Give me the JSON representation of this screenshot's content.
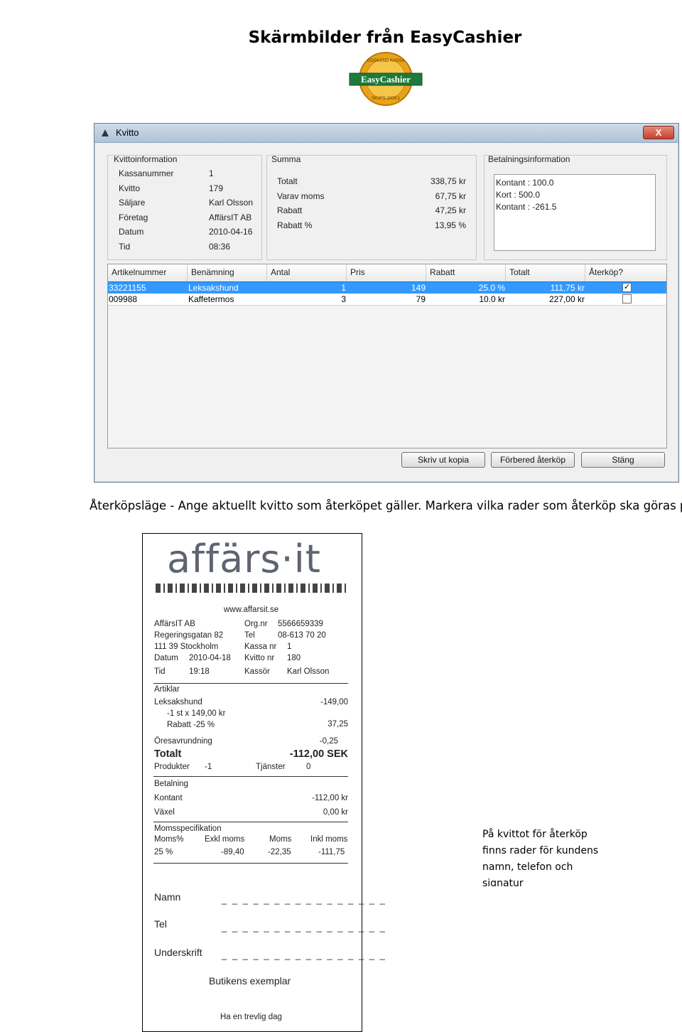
{
  "document_title": "Skärmbilder från EasyCashier",
  "logo": {
    "top_text": "GODKÄND KASSA",
    "name": "EasyCashier",
    "bottom_text": "SKVFS 2009:1"
  },
  "window": {
    "title": "Kvitto",
    "close_label": "X",
    "receipt_info": {
      "title": "Kvittoinformation",
      "rows": [
        {
          "label": "Kassanummer",
          "value": "1"
        },
        {
          "label": "Kvitto",
          "value": "179"
        },
        {
          "label": "Säljare",
          "value": "Karl Olsson"
        },
        {
          "label": "Företag",
          "value": "AffärsIT AB"
        },
        {
          "label": "Datum",
          "value": "2010-04-16"
        },
        {
          "label": "Tid",
          "value": "08:36"
        }
      ]
    },
    "summary": {
      "title": "Summa",
      "rows": [
        {
          "label": "Totalt",
          "value": "338,75 kr"
        },
        {
          "label": "Varav moms",
          "value": "67,75 kr"
        },
        {
          "label": "Rabatt",
          "value": "47,25 kr"
        },
        {
          "label": "Rabatt %",
          "value": "13,95 %"
        }
      ]
    },
    "payment": {
      "title": "Betalningsinformation",
      "lines": [
        "Kontant : 100.0",
        "Kort : 500.0",
        "Kontant : -261.5"
      ]
    },
    "grid": {
      "columns": [
        "Artikelnummer",
        "Benämning",
        "Antal",
        "Pris",
        "Rabatt",
        "Totalt",
        "Återköp?"
      ],
      "rows": [
        {
          "artnr": "33221155",
          "name": "Leksakshund",
          "qty": "1",
          "price": "149",
          "discount": "25.0 %",
          "total": "111,75 kr",
          "checked": true,
          "selected": true,
          "check_mark": "✓"
        },
        {
          "artnr": "009988",
          "name": "Kaffetermos",
          "qty": "3",
          "price": "79",
          "discount": "10.0 kr",
          "total": "227,00 kr",
          "checked": false,
          "selected": false,
          "check_mark": ""
        }
      ]
    },
    "buttons": {
      "print": "Skriv ut kopia",
      "prepare": "Förbered återköp",
      "close": "Stäng"
    }
  },
  "caption": "Återköpsläge - Ange aktuellt kvitto som återköpet gäller. Markera vilka rader som återköp ska göras på",
  "receipt": {
    "logo_text": "affärs·it",
    "website": "www.affarsit.se",
    "company": "AffärsIT AB",
    "address": "Regeringsgatan 82",
    "city": "111 39 Stockholm",
    "org_label": "Org.nr",
    "org_value": "5566659339",
    "tel_label": "Tel",
    "tel_value": "08-613 70 20",
    "kassa_label": "Kassa nr",
    "kassa_value": "1",
    "datum_label": "Datum",
    "datum_value": "2010-04-18",
    "kvitto_label": "Kvitto nr",
    "kvitto_value": "180",
    "tid_label": "Tid",
    "tid_value": "19:18",
    "kassor_label": "Kassör",
    "kassor_value": "Karl Olsson",
    "articles_header": "Artiklar",
    "item_name": "Leksakshund",
    "item_amount": "-149,00",
    "item_detail": "-1 st x 149,00 kr",
    "discount_label": "Rabatt -25 %",
    "discount_amount": "37,25",
    "rounding_label": "Öresavrundning",
    "rounding_amount": "-0,25",
    "total_label": "Totalt",
    "total_amount": "-112,00 SEK",
    "products_label": "Produkter",
    "products_value": "-1",
    "services_label": "Tjänster",
    "services_value": "0",
    "payment_header": "Betalning",
    "cash_label": "Kontant",
    "cash_value": "-112,00 kr",
    "change_label": "Växel",
    "change_value": "0,00 kr",
    "vat_header": "Momsspecifikation",
    "vat_cols": [
      "Moms%",
      "Exkl moms",
      "Moms",
      "Inkl moms"
    ],
    "vat_vals": [
      "25 %",
      "-89,40",
      "-22,35",
      "-111,75"
    ],
    "name_label": "Namn",
    "phone_label": "Tel",
    "signature_label": "Underskrift",
    "dash_line": "_ _ _ _ _ _ _ _ _ _ _ _ _ _ _ _",
    "store_copy": "Butikens exemplar",
    "goodbye": "Ha en trevlig dag"
  },
  "side_note": "På kvittot för återköp finns rader för kundens namn, telefon och signatur"
}
